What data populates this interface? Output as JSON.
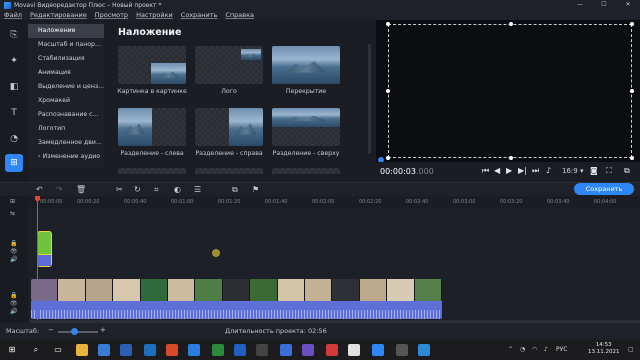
{
  "window": {
    "title": "Movavi Видеоредактор Плюс – Новый проект *",
    "controls": [
      "—",
      "☐",
      "✕"
    ]
  },
  "menu": [
    "Файл",
    "Редактирование",
    "Просмотр",
    "Настройки",
    "Сохранить",
    "Справка"
  ],
  "rail_icons": [
    "import-icon",
    "magic-wand-icon",
    "filters-icon",
    "titles-icon",
    "transitions-icon",
    "more-tools-icon"
  ],
  "categories": [
    "Наложение",
    "Масштаб и панор...",
    "Стабилизация",
    "Анимация",
    "Выделение и ценз...",
    "Хромакей",
    "Распознавание с...",
    "Логотип",
    "Замедленное дви...",
    "Изменение аудио"
  ],
  "effects": {
    "heading": "Наложение",
    "tiles": [
      "Картинка в картинке",
      "Лого",
      "Перекрытие",
      "Разделение - слева",
      "Разделение - справа",
      "Разделение - сверху"
    ]
  },
  "preview": {
    "time_main": "00:00:03",
    "time_frac": ".000",
    "ratio": "16:9 ▾"
  },
  "toolbar": {
    "save_label": "Сохранить"
  },
  "ruler": [
    "00:00:00",
    "00:00:20",
    "00:00:40",
    "00:01:00",
    "00:01:20",
    "00:01:40",
    "00:02:00",
    "00:02:20",
    "00:02:40",
    "00:03:00",
    "00:03:20",
    "00:03:40",
    "00:04:00"
  ],
  "status": {
    "zoom_label": "Масштаб:",
    "duration_label": "Длительность проекта: 02:56"
  },
  "taskbar": {
    "lang": "РУС",
    "time": "14:53",
    "date": "13.11.2021"
  }
}
